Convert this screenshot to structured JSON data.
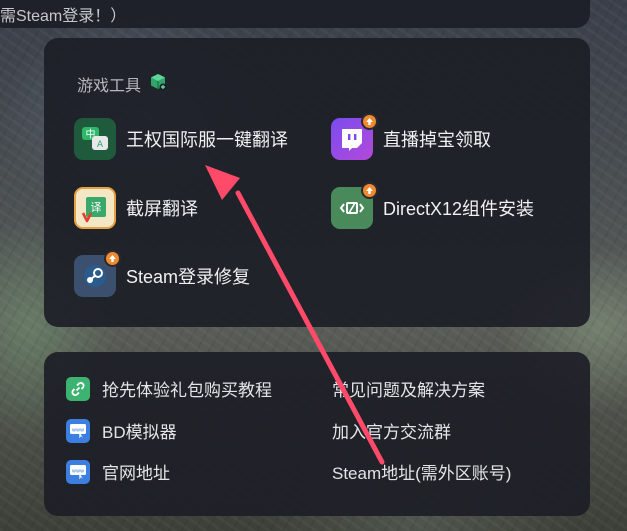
{
  "top_strip": {
    "text": "需Steam登录！）"
  },
  "tools_section": {
    "title": "游戏工具",
    "items": [
      {
        "label": "王权国际服一键翻译",
        "icon": "translate-chat-icon"
      },
      {
        "label": "直播掉宝领取",
        "icon": "twitch-drops-icon"
      },
      {
        "label": "截屏翻译",
        "icon": "screenshot-translate-icon"
      },
      {
        "label": "DirectX12组件安装",
        "icon": "directx-icon"
      },
      {
        "label": "Steam登录修复",
        "icon": "steam-icon"
      }
    ]
  },
  "links_section": {
    "items": [
      {
        "label": "抢先体验礼包购买教程",
        "icon": "link-icon"
      },
      {
        "label": "常见问题及解决方案",
        "icon": ""
      },
      {
        "label": "BD模拟器",
        "icon": "www-icon"
      },
      {
        "label": "加入官方交流群",
        "icon": ""
      },
      {
        "label": "官网地址",
        "icon": "www-icon"
      },
      {
        "label": "Steam地址(需外区账号)",
        "icon": ""
      }
    ]
  },
  "colors": {
    "panel_bg": "#1c1e26",
    "arrow": "#ff4a6a",
    "badge": "#f08a2c",
    "accent_green": "#3cb371"
  }
}
